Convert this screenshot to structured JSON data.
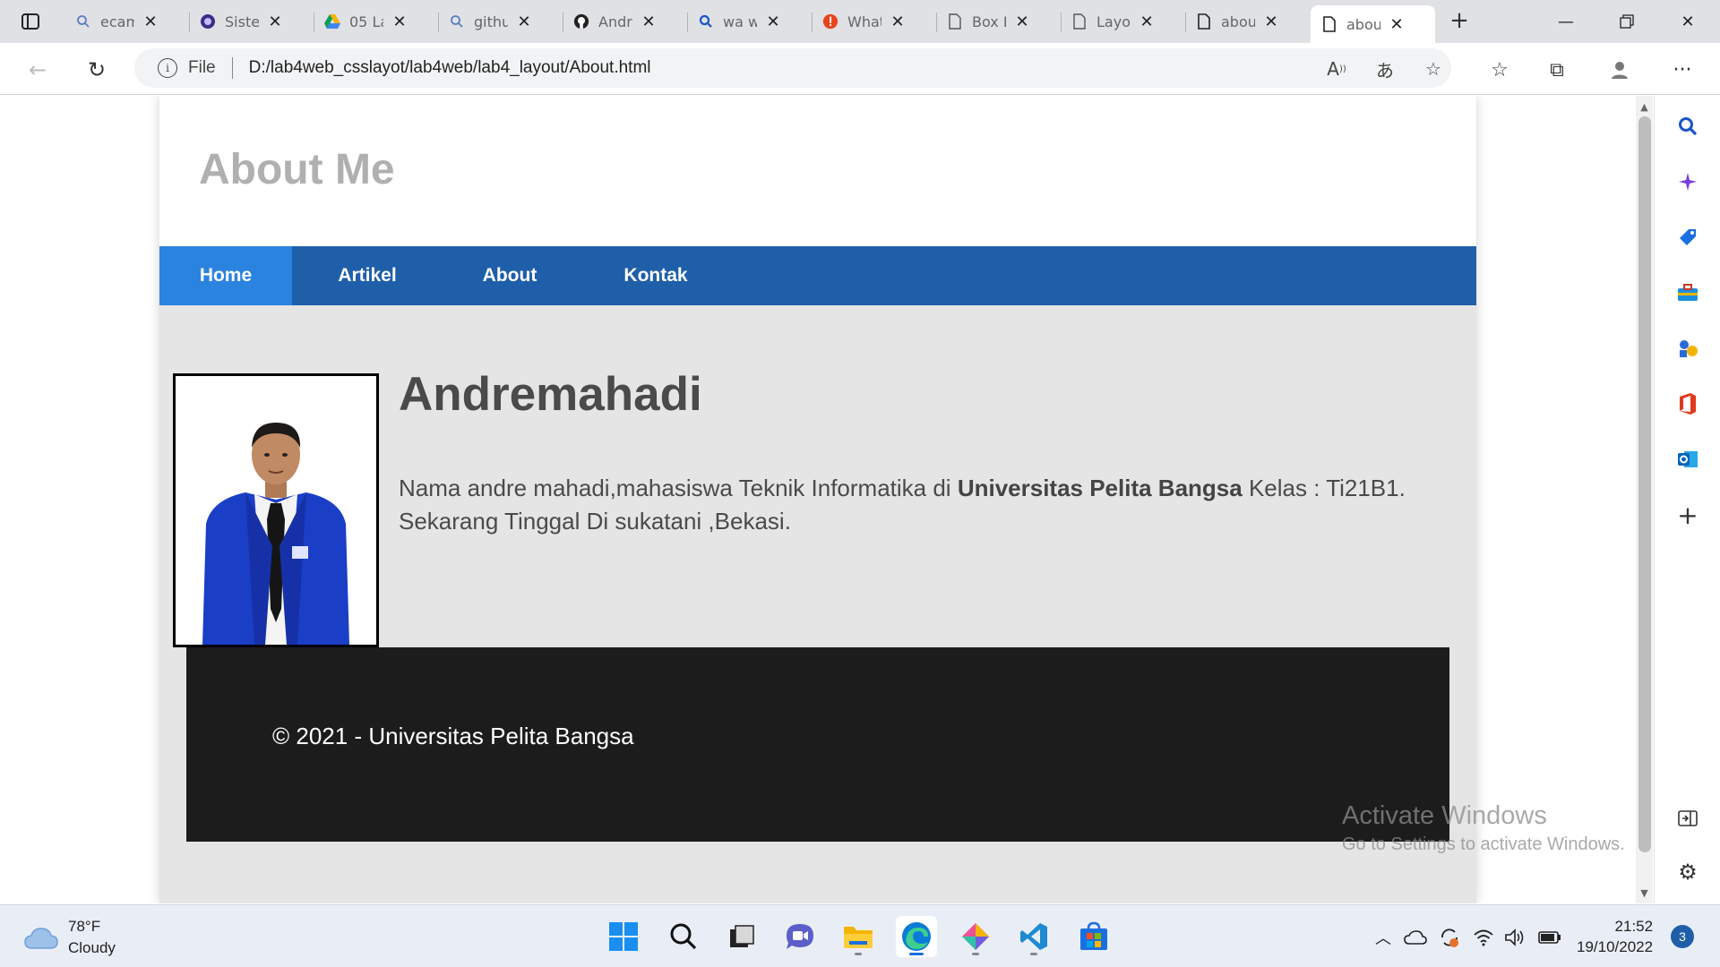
{
  "browser": {
    "tabs": [
      {
        "title": "ecam",
        "icon": "search-icon"
      },
      {
        "title": "Siste",
        "icon": "university-logo-icon"
      },
      {
        "title": "05 La",
        "icon": "google-drive-icon"
      },
      {
        "title": "githu",
        "icon": "search-icon"
      },
      {
        "title": "Andr",
        "icon": "github-icon"
      },
      {
        "title": "wa w",
        "icon": "search-icon"
      },
      {
        "title": "What",
        "icon": "alert-icon"
      },
      {
        "title": "Box E",
        "icon": "page-icon"
      },
      {
        "title": "Layo",
        "icon": "page-icon"
      },
      {
        "title": "abou",
        "icon": "page-icon"
      },
      {
        "title": "abou",
        "icon": "page-icon",
        "active": true
      }
    ],
    "address": {
      "scheme_label": "File",
      "url": "D:/lab4web_csslayot/lab4web/lab4_layout/About.html"
    }
  },
  "page": {
    "header_title": "About Me",
    "nav": [
      "Home",
      "Artikel",
      "About",
      "Kontak"
    ],
    "active_nav": "Home",
    "heading": "Andremahadi",
    "bio": {
      "before": "Nama andre mahadi,mahasiswa Teknik Informatika di ",
      "bold": "Universitas Pelita Bangsa",
      "after": " Kelas : Ti21B1. Sekarang Tinggal Di sukatani ,Bekasi."
    },
    "footer": "© 2021 - Universitas Pelita Bangsa"
  },
  "watermark": {
    "line1": "Activate Windows",
    "line2": "Go to Settings to activate Windows."
  },
  "taskbar": {
    "weather_temp": "78°F",
    "weather_desc": "Cloudy",
    "time": "21:52",
    "date": "19/10/2022",
    "notification_count": "3"
  },
  "colors": {
    "nav_bg": "#1f5faa",
    "nav_active": "#2b83e0",
    "footer_bg": "#1c1c1c",
    "page_bg": "#e5e5e5"
  }
}
